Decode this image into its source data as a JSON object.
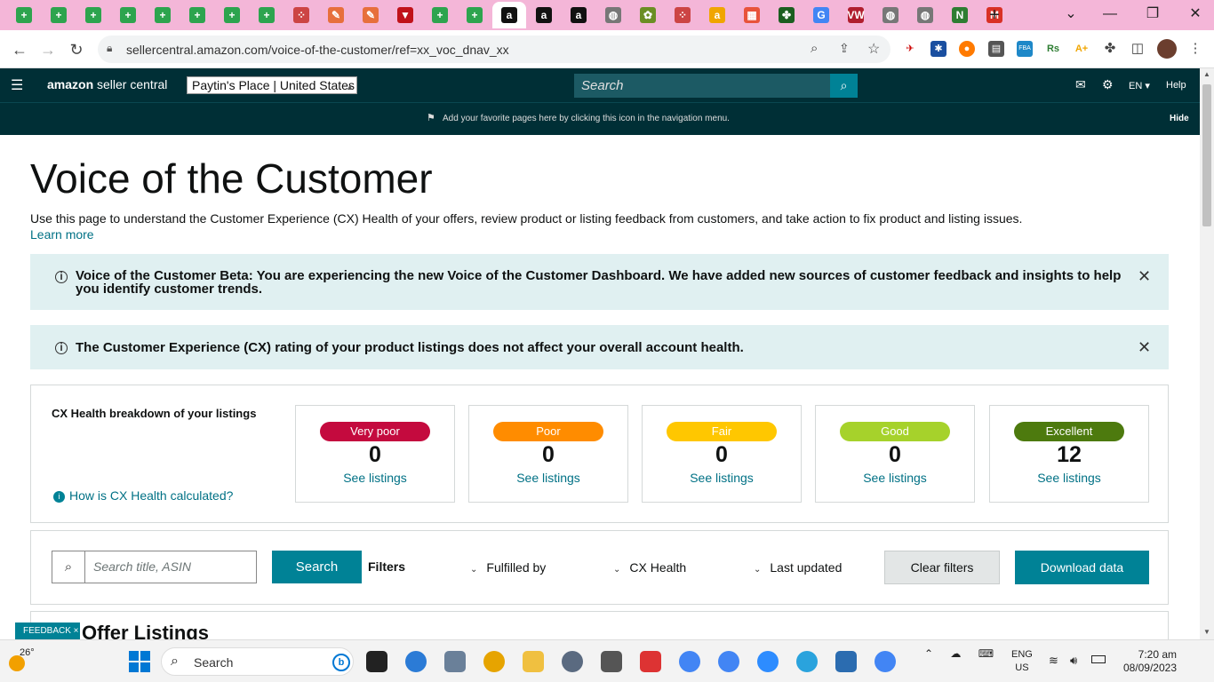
{
  "browser": {
    "url": "sellercentral.amazon.com/voice-of-the-customer/ref=xx_voc_dnav_xx",
    "tabs": [
      {
        "icon": "green-plus-icon",
        "color": "#2da44e",
        "glyph": "+"
      },
      {
        "icon": "green-plus-icon",
        "color": "#2da44e",
        "glyph": "+"
      },
      {
        "icon": "green-plus-icon",
        "color": "#2da44e",
        "glyph": "+"
      },
      {
        "icon": "green-plus-icon",
        "color": "#2da44e",
        "glyph": "+"
      },
      {
        "icon": "green-plus-icon",
        "color": "#2da44e",
        "glyph": "+"
      },
      {
        "icon": "green-plus-icon",
        "color": "#2da44e",
        "glyph": "+"
      },
      {
        "icon": "green-plus-icon",
        "color": "#2da44e",
        "glyph": "+"
      },
      {
        "icon": "green-plus-icon",
        "color": "#2da44e",
        "glyph": "+"
      },
      {
        "icon": "app-icon",
        "color": "#c44",
        "glyph": "⁘"
      },
      {
        "icon": "pen-icon",
        "color": "#e76f3c",
        "glyph": "✎"
      },
      {
        "icon": "pen-icon",
        "color": "#e76f3c",
        "glyph": "✎"
      },
      {
        "icon": "red-v-icon",
        "color": "#c0121a",
        "glyph": "▼"
      },
      {
        "icon": "green-plus-icon",
        "color": "#2da44e",
        "glyph": "+"
      },
      {
        "icon": "green-plus-icon",
        "color": "#2da44e",
        "glyph": "+"
      },
      {
        "icon": "amazon-icon",
        "color": "#111",
        "glyph": "a"
      },
      {
        "icon": "amazon-icon",
        "color": "#111",
        "glyph": "a"
      },
      {
        "icon": "amazon-icon",
        "color": "#111",
        "glyph": "a"
      },
      {
        "icon": "globe-icon",
        "color": "#777",
        "glyph": "◍"
      },
      {
        "icon": "plant-icon",
        "color": "#6b8e23",
        "glyph": "✿"
      },
      {
        "icon": "app-icon",
        "color": "#c44",
        "glyph": "⁘"
      },
      {
        "icon": "amazon-smile-icon",
        "color": "#f0a500",
        "glyph": "a"
      },
      {
        "icon": "grid-apps-icon",
        "color": "#e8533b",
        "glyph": "▦"
      },
      {
        "icon": "puzzle-icon",
        "color": "#1b5e20",
        "glyph": "✤"
      },
      {
        "icon": "google-icon",
        "color": "#4285f4",
        "glyph": "G"
      },
      {
        "icon": "vw-icon",
        "color": "#b01e2e",
        "glyph": "VW"
      },
      {
        "icon": "globe-icon",
        "color": "#777",
        "glyph": "◍"
      },
      {
        "icon": "globe-icon",
        "color": "#777",
        "glyph": "◍"
      },
      {
        "icon": "n-icon",
        "color": "#2e7d32",
        "glyph": "N"
      },
      {
        "icon": "gmail-icon",
        "color": "#d93025",
        "glyph": "M"
      }
    ],
    "active_tab_index": 14,
    "new_tab_glyph": "+"
  },
  "seller_nav": {
    "logo_brand": "amazon",
    "logo_suffix": "seller central",
    "account": "Paytin's Place | United States",
    "search_placeholder": "Search",
    "language": "EN",
    "help": "Help",
    "favorites_message": "Add your favorite pages here by clicking this icon in the navigation menu.",
    "hide": "Hide"
  },
  "page": {
    "title": "Voice of the Customer",
    "description": "Use this page to understand the Customer Experience (CX) Health of your offers, review product or listing feedback from customers, and take action to fix product and listing issues.",
    "learn_more": "Learn more",
    "alerts": [
      {
        "text": "Voice of the Customer Beta: You are experiencing the new Voice of the Customer Dashboard. We have added new sources of customer feedback and insights to help you identify customer trends."
      },
      {
        "text": "The Customer Experience (CX) rating of your product listings does not affect your overall account health."
      }
    ],
    "health": {
      "heading": "CX Health breakdown of your listings",
      "how_link": "How is CX Health calculated?",
      "cards": [
        {
          "label": "Very poor",
          "count": "0",
          "link": "See listings",
          "color": "#c40a3e",
          "text_color": "#ffffff"
        },
        {
          "label": "Poor",
          "count": "0",
          "link": "See listings",
          "color": "#ff8c00",
          "text_color": "#ffffff"
        },
        {
          "label": "Fair",
          "count": "0",
          "link": "See listings",
          "color": "#ffc700",
          "text_color": "#ffffff"
        },
        {
          "label": "Good",
          "count": "0",
          "link": "See listings",
          "color": "#a6d22b",
          "text_color": "#ffffff"
        },
        {
          "label": "Excellent",
          "count": "12",
          "link": "See listings",
          "color": "#4d7a0e",
          "text_color": "#ffffff"
        }
      ]
    },
    "filters": {
      "search_placeholder": "Search title, ASIN",
      "search_button": "Search",
      "label": "Filters",
      "dropdowns": [
        "Fulfilled by",
        "CX Health",
        "Last updated"
      ],
      "clear": "Clear filters",
      "download": "Download data"
    },
    "offer_listings_title": "Offer Listings",
    "feedback_tab": "FEEDBACK ×"
  },
  "taskbar": {
    "temperature": "26°",
    "search_label": "Search",
    "language": "ENG",
    "region": "US",
    "time": "7:20 am",
    "date": "08/09/2023"
  }
}
